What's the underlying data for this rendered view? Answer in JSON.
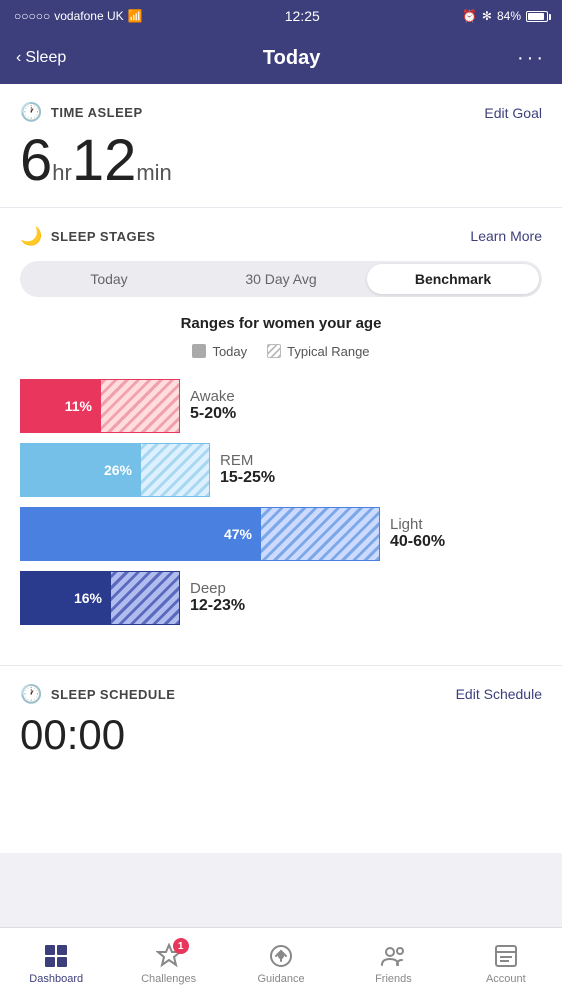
{
  "statusBar": {
    "carrier": "vodafone UK",
    "time": "12:25",
    "alarm": "⏰",
    "bluetooth": "✻",
    "battery": "84%"
  },
  "navBar": {
    "backLabel": "Sleep",
    "title": "Today",
    "dots": "○ ○ ○"
  },
  "timeAsleep": {
    "sectionTitle": "TIME ASLEEP",
    "editLabel": "Edit Goal",
    "hours": "6",
    "hrUnit": "hr",
    "minutes": "12",
    "minUnit": "min"
  },
  "sleepStages": {
    "sectionTitle": "SLEEP STAGES",
    "learnMoreLabel": "Learn More",
    "tabs": [
      {
        "label": "Today",
        "active": false
      },
      {
        "label": "30 Day Avg",
        "active": false
      },
      {
        "label": "Benchmark",
        "active": true
      }
    ],
    "chartTitle": "Ranges for women your age",
    "legend": {
      "todayLabel": "Today",
      "typicalLabel": "Typical Range"
    },
    "bars": [
      {
        "name": "Awake",
        "percentage": "11%",
        "range": "5-20%",
        "solidWidth": 80,
        "hatchedWidth": 80,
        "type": "awake"
      },
      {
        "name": "REM",
        "percentage": "26%",
        "range": "15-25%",
        "solidWidth": 120,
        "hatchedWidth": 70,
        "type": "rem"
      },
      {
        "name": "Light",
        "percentage": "47%",
        "range": "40-60%",
        "solidWidth": 240,
        "hatchedWidth": 120,
        "type": "light"
      },
      {
        "name": "Deep",
        "percentage": "16%",
        "range": "12-23%",
        "solidWidth": 90,
        "hatchedWidth": 70,
        "type": "deep"
      }
    ]
  },
  "sleepSchedule": {
    "sectionTitle": "SLEEP SCHEDULE",
    "editLabel": "Edit Schedule",
    "time": "00:00"
  },
  "bottomNav": [
    {
      "label": "Dashboard",
      "active": true,
      "icon": "dashboard"
    },
    {
      "label": "Challenges",
      "active": false,
      "icon": "challenges",
      "badge": "1"
    },
    {
      "label": "Guidance",
      "active": false,
      "icon": "guidance"
    },
    {
      "label": "Friends",
      "active": false,
      "icon": "friends"
    },
    {
      "label": "Account",
      "active": false,
      "icon": "account"
    }
  ]
}
